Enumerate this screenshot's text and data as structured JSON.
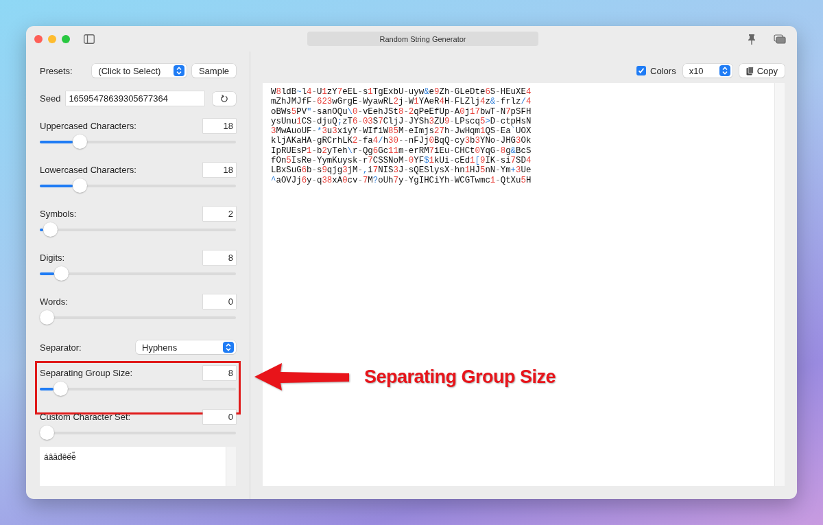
{
  "window": {
    "title": "Random String Generator"
  },
  "sidebar": {
    "presets": {
      "label": "Presets:",
      "value": "(Click to Select)",
      "button": "Sample"
    },
    "seed": {
      "label": "Seed",
      "value": "16595478639305677364"
    },
    "controls": [
      {
        "kind": "slider",
        "label": "Uppercased Characters:",
        "value": "18",
        "level": 0.18,
        "highlighted": false
      },
      {
        "kind": "slider",
        "label": "Lowercased Characters:",
        "value": "18",
        "level": 0.18,
        "highlighted": false
      },
      {
        "kind": "slider",
        "label": "Symbols:",
        "value": "2",
        "level": 0.02,
        "highlighted": false
      },
      {
        "kind": "slider",
        "label": "Digits:",
        "value": "8",
        "level": 0.08,
        "highlighted": false
      },
      {
        "kind": "slider",
        "label": "Words:",
        "value": "0",
        "level": 0,
        "highlighted": false
      },
      {
        "kind": "select",
        "label": "Separator:",
        "value": "Hyphens",
        "highlighted": false
      },
      {
        "kind": "slider",
        "label": "Separating Group Size:",
        "value": "8",
        "level": 0.075,
        "highlighted": true
      },
      {
        "kind": "slider",
        "label": "Custom Character Set:",
        "value": "0",
        "level": 0,
        "highlighted": false
      }
    ],
    "custom_set": "áâăđêếễ"
  },
  "toolbar": {
    "colors": {
      "label": "Colors",
      "checked": true
    },
    "count": "x10",
    "copy": "Copy"
  },
  "output": [
    "W8ldB~l4-U1zY7eEL-s1TgExbU-uyw&e9Zh-GLeDte6S-HEuXE4",
    "mZhJMJfF-623wGrgE-WyawRL2j-W1YAeR4H-FLZlj4z&-frlz/4",
    "oBWs5PV\"-sanOQu\\0-vEehJSt8-2qPeEfUp-A0j17bwT-N7pSFH",
    "ysUnu1CS-djuQ;zT6-03S7CljJ-JYSh3ZU9-LPscq5>D-ctpHsN",
    "3MwAuoUF-*3u3xiyY-WIfiW85M-eImjs27h-JwHqm1QS-Ea`UOX",
    "kljAKaHA-gRCrhLK2-fa4/h30--nFJj0BqQ-cy3b3YNo-JHG3Ok",
    "IpRUEsP1-b2yTeh\\r-Qg6Gc11m-erRM7iEu-CHCt0YqG-8g&BcS",
    "fOn5IsRe-YymKuysk-r7CSSNoM-0YF$1kUi-cEd1[9IK-si7SD4",
    "LBxSuG6b-s9qjg3jM-,i7NIS3J-sQESlysX-hn1HJ5nN-Ym+3Ue",
    "^aOVJj6y-q38xA0cv-7M?oUh7y-YgIHCiYh-WCGTwmc1-QtXu5H"
  ],
  "annotation": {
    "label": "Separating Group Size"
  }
}
